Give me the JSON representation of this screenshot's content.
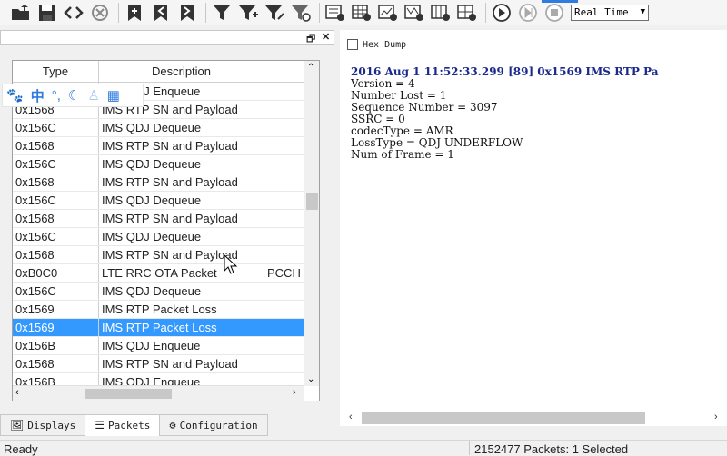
{
  "toolbar": {
    "icons": [
      "open-folder-icon",
      "save-icon",
      "code-icon",
      "refresh-icon",
      "bookmark-add-icon",
      "bookmark-prev-icon",
      "bookmark-next-icon",
      "filter-icon",
      "filter-add-icon",
      "filter-edit-icon",
      "filter-clear-icon",
      "new-window-icon",
      "new-table-icon",
      "new-chart-icon",
      "new-map-icon",
      "new-grid-icon",
      "new-view-icon",
      "play-icon",
      "step-icon",
      "stop-icon"
    ],
    "mode_select": "Real Time"
  },
  "table": {
    "columns": [
      "Type",
      "Description",
      ""
    ],
    "rows": [
      {
        "type": "",
        "desc": "IMS QDJ Enqueue",
        "extra": ""
      },
      {
        "type": "0x1568",
        "desc": "IMS RTP SN and Payload",
        "extra": ""
      },
      {
        "type": "0x156C",
        "desc": "IMS QDJ Dequeue",
        "extra": ""
      },
      {
        "type": "0x1568",
        "desc": "IMS RTP SN and Payload",
        "extra": ""
      },
      {
        "type": "0x156C",
        "desc": "IMS QDJ Dequeue",
        "extra": ""
      },
      {
        "type": "0x1568",
        "desc": "IMS RTP SN and Payload",
        "extra": ""
      },
      {
        "type": "0x156C",
        "desc": "IMS QDJ Dequeue",
        "extra": ""
      },
      {
        "type": "0x1568",
        "desc": "IMS RTP SN and Payload",
        "extra": ""
      },
      {
        "type": "0x156C",
        "desc": "IMS QDJ Dequeue",
        "extra": ""
      },
      {
        "type": "0x1568",
        "desc": "IMS RTP SN and Payload",
        "extra": ""
      },
      {
        "type": "0xB0C0",
        "desc": "LTE RRC OTA Packet",
        "extra": "PCCH /"
      },
      {
        "type": "0x156C",
        "desc": "IMS QDJ Dequeue",
        "extra": ""
      },
      {
        "type": "0x1569",
        "desc": "IMS RTP Packet Loss",
        "extra": ""
      },
      {
        "type": "0x1569",
        "desc": "IMS RTP Packet Loss",
        "extra": ""
      },
      {
        "type": "0x156B",
        "desc": "IMS QDJ Enqueue",
        "extra": ""
      },
      {
        "type": "0x1568",
        "desc": "IMS RTP SN and Payload",
        "extra": ""
      },
      {
        "type": "0x156B",
        "desc": "IMS QDJ Enqueue",
        "extra": ""
      }
    ],
    "selected_index": 13
  },
  "tabs": [
    "Displays",
    "Packets",
    "Configuration"
  ],
  "hex_dump_label": "Hex Dump",
  "detail": {
    "header": "2016 Aug  1  11:52:33.299  [89]  0x1569  IMS RTP Pa",
    "lines": [
      "Version = 4",
      "Number Lost = 1",
      "Sequence Number = 3097",
      "SSRC = 0",
      "codecType = AMR",
      "LossType = QDJ UNDERFLOW",
      "Num of Frame = 1"
    ]
  },
  "status": {
    "left": "Ready",
    "right": "2152477 Packets: 1 Selected"
  }
}
